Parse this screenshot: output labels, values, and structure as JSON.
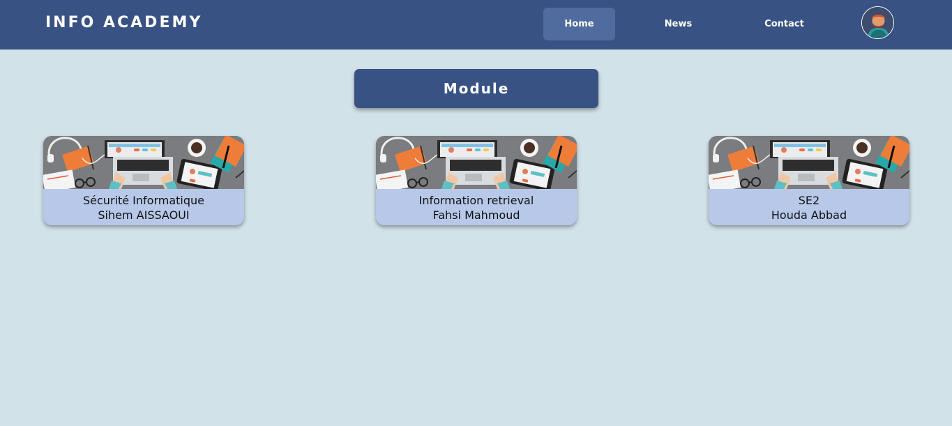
{
  "header": {
    "brand": "INFO ACADEMY",
    "nav": [
      {
        "label": "Home",
        "active": true
      },
      {
        "label": "News",
        "active": false
      },
      {
        "label": "Contact",
        "active": false
      }
    ]
  },
  "main": {
    "title": "Module",
    "modules": [
      {
        "name": "Sécurité Informatique",
        "teacher": "Sihem AISSAOUI"
      },
      {
        "name": "Information retrieval",
        "teacher": "Fahsi Mahmoud"
      },
      {
        "name": "SE2",
        "teacher": "Houda Abbad"
      }
    ]
  },
  "colors": {
    "header_bg": "#375283",
    "page_bg": "#d2e2e9",
    "card_body_bg": "#b7c8e9",
    "active_nav_bg": "#506b9e"
  }
}
